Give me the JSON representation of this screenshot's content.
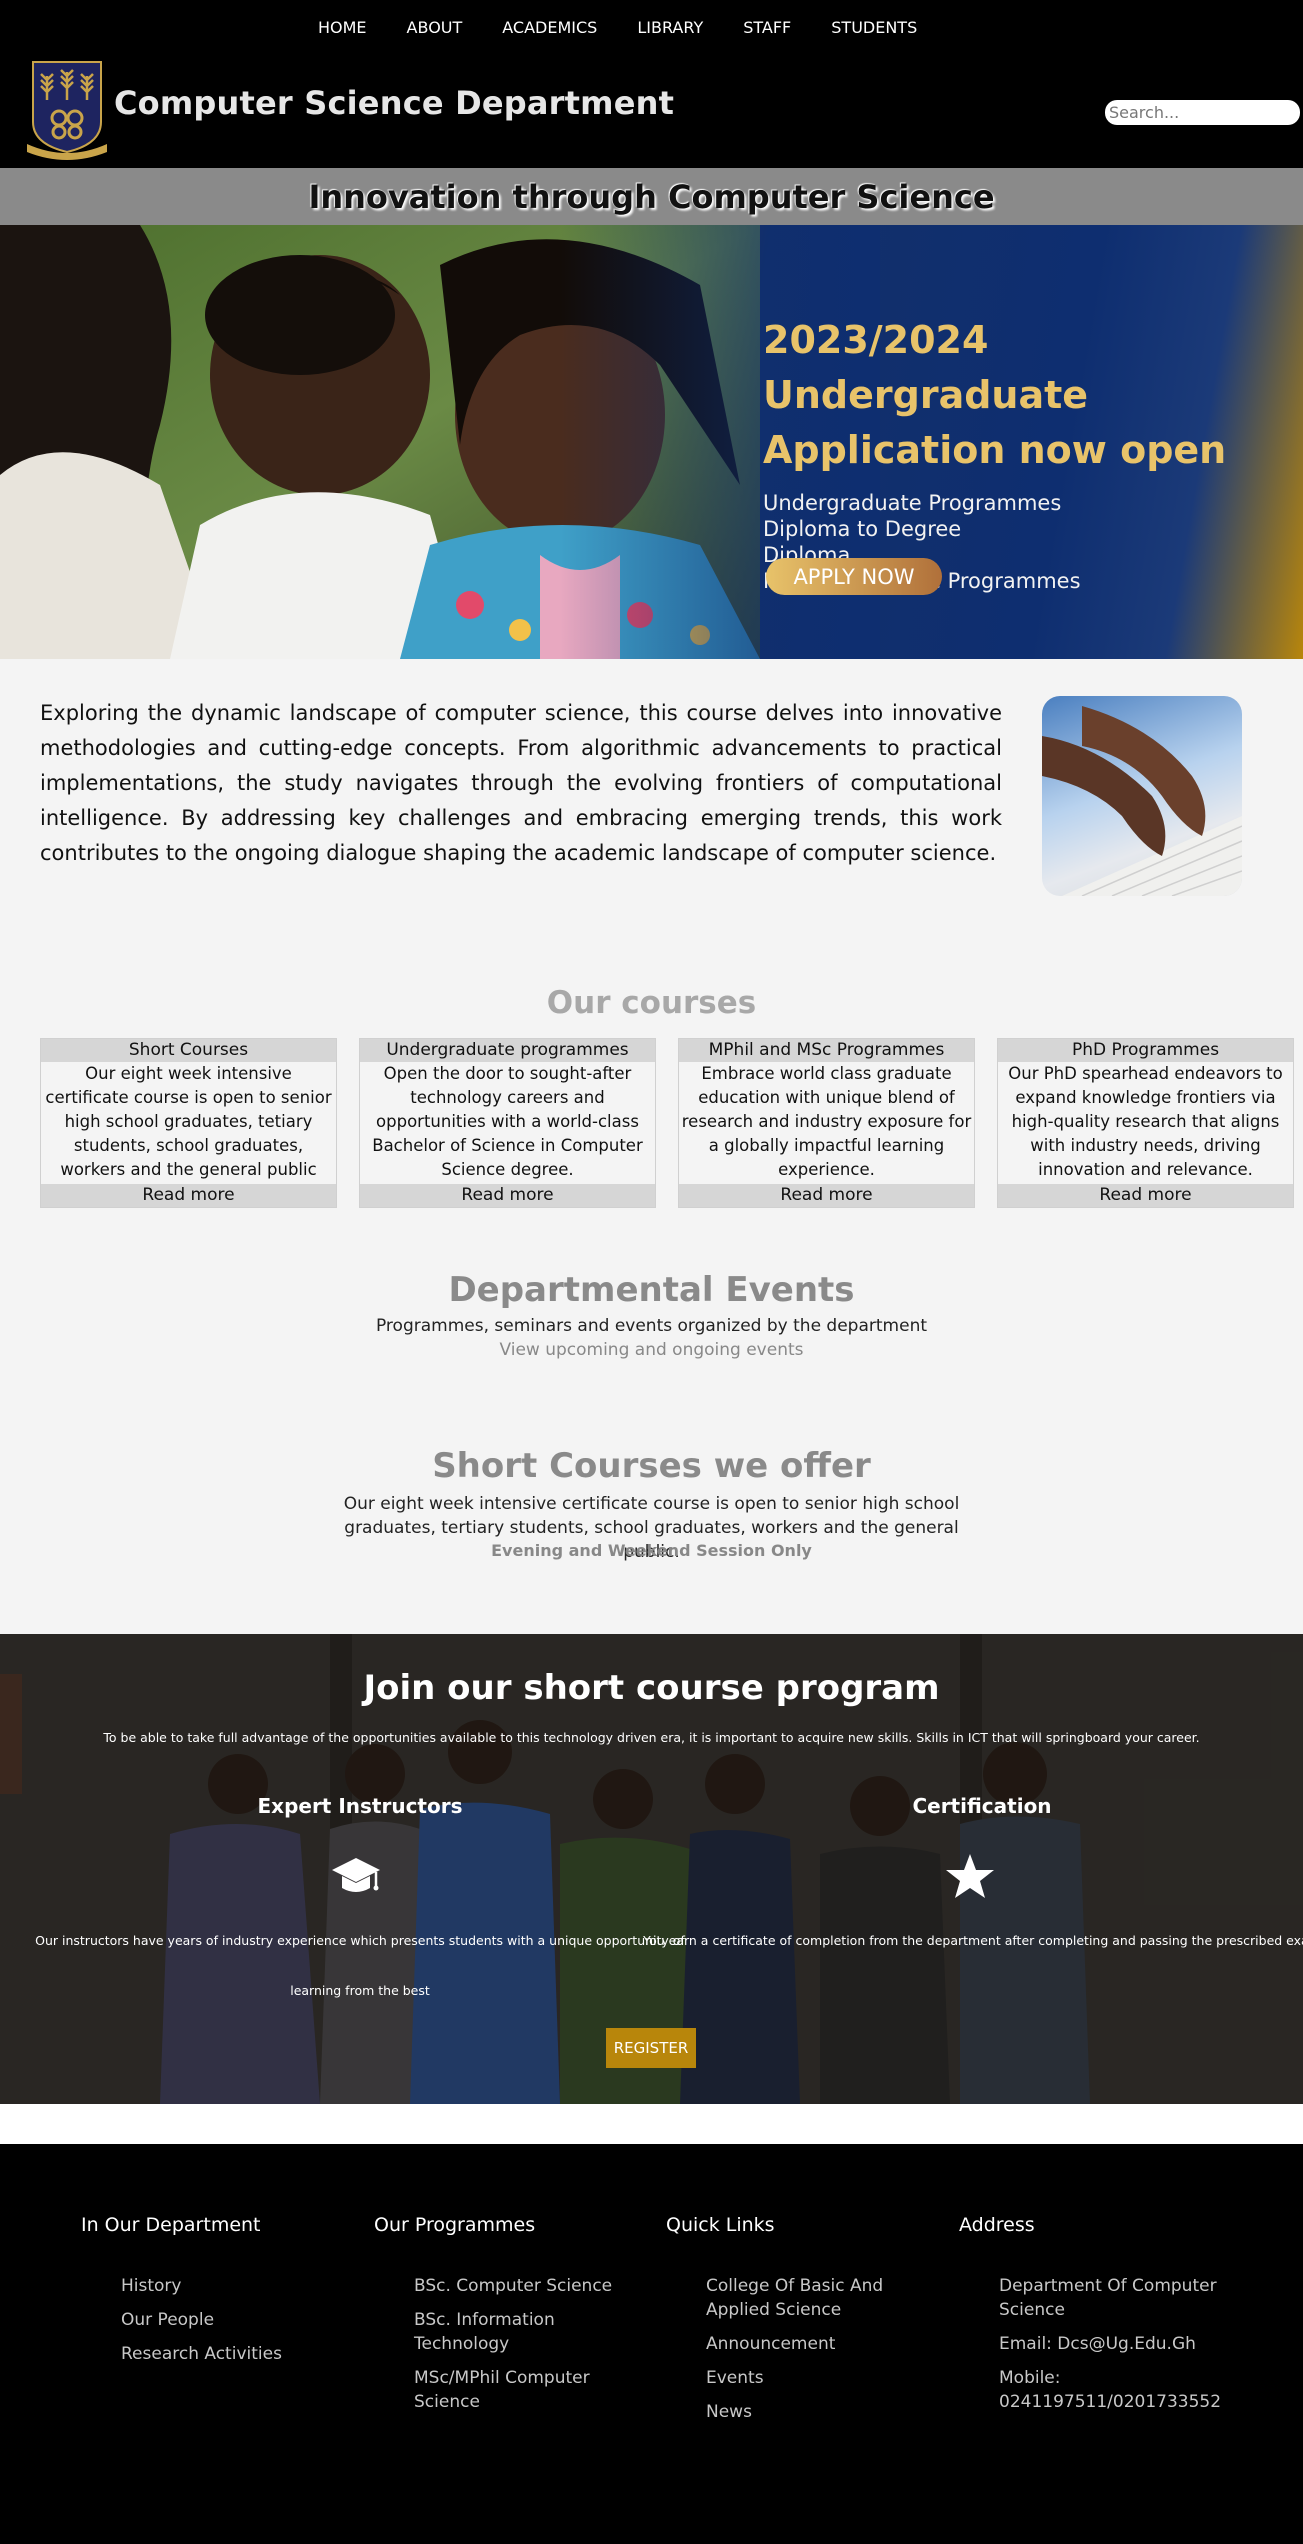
{
  "nav": [
    "HOME",
    "ABOUT",
    "ACADEMICS",
    "LIBRARY",
    "STAFF",
    "STUDENTS"
  ],
  "header": {
    "title": "Computer Science Department",
    "search_placeholder": "Search..."
  },
  "tagline": "Innovation through Computer Science",
  "hero": {
    "headline_1": "2023/2024 Undergraduate",
    "headline_2": "Application now open",
    "programmes": [
      "Undergraduate Programmes",
      "Diploma to Degree",
      "Diploma",
      "Post First Degree Programmes"
    ],
    "apply_label": "APPLY NOW"
  },
  "intro": "Exploring the dynamic landscape of computer science, this course delves into innovative methodologies and cutting-edge concepts. From algorithmic advancements to practical implementations, the study navigates through the evolving frontiers of computational intelligence. By addressing key challenges and embracing emerging trends, this work contributes to the ongoing dialogue shaping the academic landscape of computer science.",
  "courses": {
    "title": "Our courses",
    "items": [
      {
        "title": "Short Courses",
        "body": "Our eight week intensive certificate course is open to senior high school graduates, tetiary students, school graduates, workers and the general public",
        "more": "Read more"
      },
      {
        "title": "Undergraduate programmes",
        "body": "Open the door to sought-after technology careers and opportunities with a world-class Bachelor of Science in Computer Science degree.",
        "more": "Read more"
      },
      {
        "title": "MPhil and MSc Programmes",
        "body": "Embrace world class graduate education with unique blend of research and industry exposure for a globally impactful learning experience.",
        "more": "Read more"
      },
      {
        "title": "PhD Programmes",
        "body": "Our PhD spearhead endeavors to expand knowledge frontiers via high-quality research that aligns with industry needs, driving innovation and relevance.",
        "more": "Read more"
      }
    ]
  },
  "events": {
    "title": "Departmental Events",
    "subtitle": "Programmes, seminars and events organized by the department",
    "link": "View upcoming and ongoing events"
  },
  "short_courses": {
    "title": "Short Courses we offer",
    "text": "Our eight week intensive certificate course is open to senior high school graduates, tertiary students, school graduates, workers and the general public.",
    "note": "Evening and Weekend Session Only"
  },
  "join": {
    "title": "Join our short course program",
    "subtitle": "To be able to take full advantage of the opportunities available to this technology driven era, it is important to acquire new skills. Skills in ICT that will springboard your career.",
    "features": [
      {
        "title": "Expert Instructors",
        "icon": "graduation-cap-icon",
        "text": "Our instructors have years of industry experience which presents students with a unique opportunity of learning from the best"
      },
      {
        "title": "Certification",
        "icon": "star-icon",
        "text": "You earn a certificate of completion from the department after completing and passing the prescribed exam"
      }
    ],
    "register_label": "REGISTER"
  },
  "footer": {
    "columns": [
      {
        "heading": "In Our Department",
        "links": [
          "History",
          "Our People",
          "Research Activities"
        ]
      },
      {
        "heading": "Our Programmes",
        "links": [
          "BSc. Computer Science",
          "BSc. Information Technology",
          "MSc/MPhil Computer Science"
        ]
      },
      {
        "heading": "Quick Links",
        "links": [
          "College Of Basic And Applied Science",
          "Announcement",
          "Events",
          "News"
        ]
      },
      {
        "heading": "Address",
        "links": [
          "Department Of Computer Science",
          "Email: Dcs@Ug.Edu.Gh",
          "Mobile: 0241197511/0201733552"
        ]
      }
    ]
  },
  "colors": {
    "accent_gold": "#b8860b",
    "hero_headline": "#e8c36a",
    "hero_blue": "#0e2e70"
  }
}
